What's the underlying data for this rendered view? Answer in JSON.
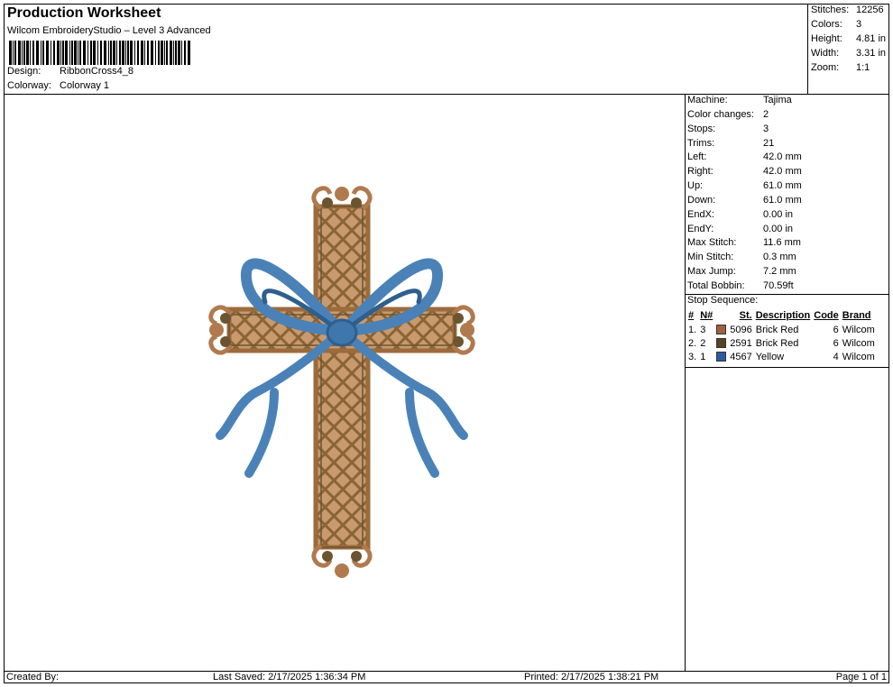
{
  "header": {
    "title": "Production Worksheet",
    "subtitle": "Wilcom EmbroideryStudio – Level 3 Advanced",
    "design_label": "Design:",
    "design_value": "RibbonCross4_8",
    "colorway_label": "Colorway:",
    "colorway_value": "Colorway 1"
  },
  "stats": {
    "stitches_label": "Stitches:",
    "stitches": "12256",
    "colors_label": "Colors:",
    "colors": "3",
    "height_label": "Height:",
    "height": "4.81 in",
    "width_label": "Width:",
    "width": "3.31 in",
    "zoom_label": "Zoom:",
    "zoom": "1:1"
  },
  "info": {
    "machine_label": "Machine:",
    "machine": "Tajima",
    "color_changes_label": "Color changes:",
    "color_changes": "2",
    "stops_label": "Stops:",
    "stops": "3",
    "trims_label": "Trims:",
    "trims": "21",
    "left_label": "Left:",
    "left": "42.0 mm",
    "right_label": "Right:",
    "right": "42.0 mm",
    "up_label": "Up:",
    "up": "61.0 mm",
    "down_label": "Down:",
    "down": "61.0 mm",
    "endx_label": "EndX:",
    "endx": "0.00 in",
    "endy_label": "EndY:",
    "endy": "0.00 in",
    "max_stitch_label": "Max Stitch:",
    "max_stitch": "11.6 mm",
    "min_stitch_label": "Min Stitch:",
    "min_stitch": "0.3 mm",
    "max_jump_label": "Max Jump:",
    "max_jump": "7.2 mm",
    "total_bobbin_label": "Total Bobbin:",
    "total_bobbin": "70.59ft"
  },
  "stop_sequence": {
    "title": "Stop Sequence:",
    "headers": {
      "num": "#",
      "n": "N#",
      "st": "St.",
      "description": "Description",
      "code": "Code",
      "brand": "Brand"
    },
    "rows": [
      {
        "num": "1.",
        "n": "3",
        "swatch": "#a0603f",
        "st": "5096",
        "description": "Brick Red",
        "code": "6",
        "brand": "Wilcom"
      },
      {
        "num": "2.",
        "n": "2",
        "swatch": "#5b4320",
        "st": "2591",
        "description": "Brick Red",
        "code": "6",
        "brand": "Wilcom"
      },
      {
        "num": "3.",
        "n": "1",
        "swatch": "#2a5ba0",
        "st": "4567",
        "description": "Yellow",
        "code": "4",
        "brand": "Wilcom"
      }
    ]
  },
  "footer": {
    "created_by": "Created By:",
    "last_saved": "Last Saved: 2/17/2025 1:36:34 PM",
    "printed": "Printed: 2/17/2025 1:38:21 PM",
    "page": "Page 1 of 1"
  },
  "colors": {
    "brown": "#b07a4e",
    "dark_brown": "#6b5530",
    "ribbon_blue": "#4a82b8",
    "ribbon_dark": "#2e5f8e"
  }
}
